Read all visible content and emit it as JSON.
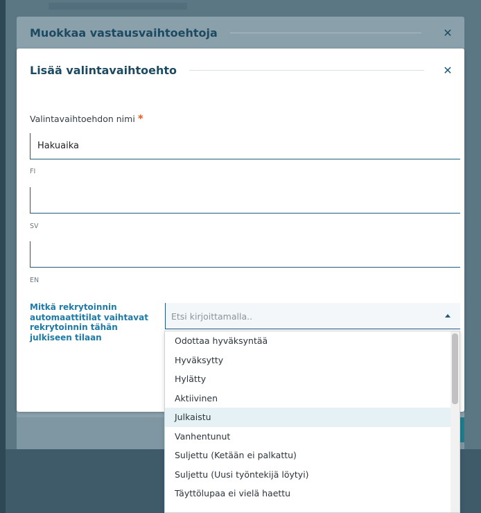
{
  "outer_modal": {
    "title": "Muokkaa vastausvaihtoehtoja",
    "close_glyph": "✕"
  },
  "inner_modal": {
    "title": "Lisää valintavaihtoehto",
    "close_glyph": "✕",
    "name_label": "Valintavaihtoehdon nimi",
    "required_mark": "*",
    "name_fi_value": "Hakuaika",
    "lang_fi": "FI",
    "name_sv_value": "",
    "lang_sv": "SV",
    "name_en_value": "",
    "lang_en": "EN",
    "status_question": "Mitkä rekrytoinnin automaattitilat vaihtavat rekrytoinnin tähän julkiseen tilaan",
    "search_placeholder": "Etsi kirjoittamalla.."
  },
  "dropdown": {
    "options": [
      "Odottaa hyväksyntää",
      "Hyväksytty",
      "Hylätty",
      "Aktiivinen",
      "Julkaistu",
      "Vanhentunut",
      "Suljettu (Ketään ei palkattu)",
      "Suljettu (Uusi työntekijä löytyi)",
      "Täyttölupaa ei vielä haettu"
    ],
    "highlighted": "Julkaistu"
  },
  "colors": {
    "brand_dark": "#1d4a60",
    "link_blue": "#1e7aa6",
    "required": "#e45a21",
    "accent_teal": "#1e7d8a"
  }
}
